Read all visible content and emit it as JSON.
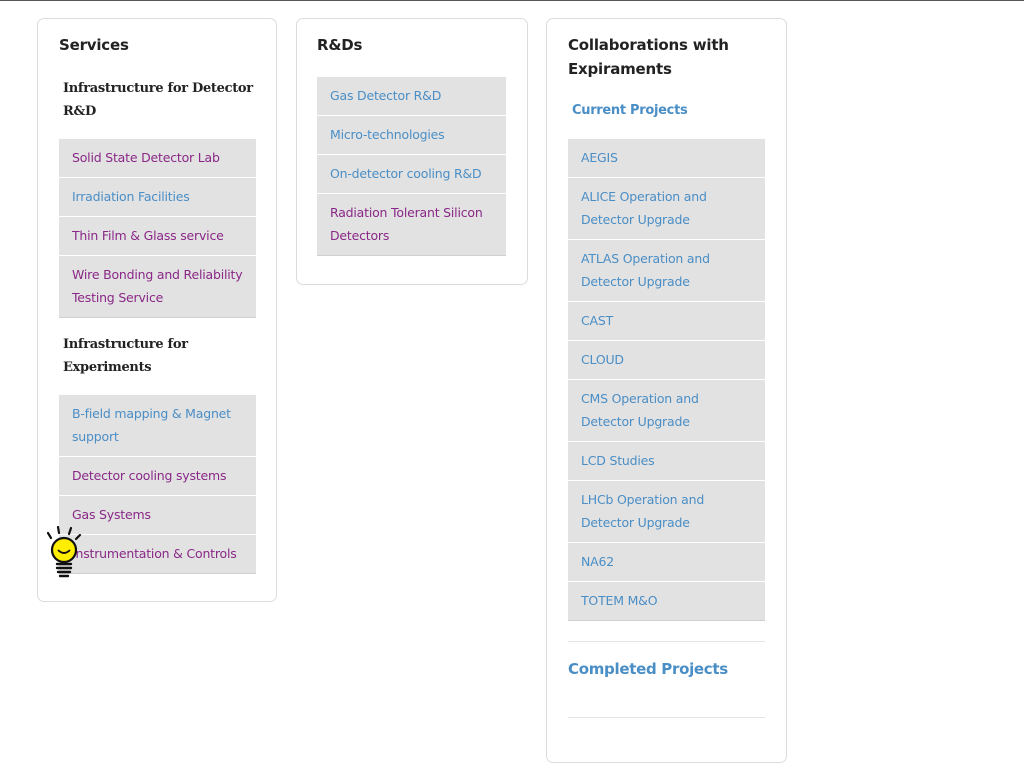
{
  "services": {
    "title": "Services",
    "detector_rnd_heading": "Infrastructure for Detector R&D",
    "detector_rnd_items": [
      {
        "label": "Solid State Detector Lab",
        "color": "#8a2887"
      },
      {
        "label": "Irradiation Facilities",
        "color": "#4a8ec6"
      },
      {
        "label": "Thin Film & Glass service",
        "color": "#8a2887"
      },
      {
        "label": "Wire Bonding and Reliability Testing Service",
        "color": "#8a2887"
      }
    ],
    "experiments_heading": "Infrastructure for Experiments",
    "experiments_items": [
      {
        "label": "B-field mapping & Magnet support",
        "color": "#4a8ec6"
      },
      {
        "label": "Detector cooling systems",
        "color": "#8a2887"
      },
      {
        "label": "Gas Systems",
        "color": "#8a2887"
      },
      {
        "label": "Instrumentation & Controls",
        "color": "#8a2887"
      }
    ]
  },
  "rnd": {
    "title": "R&Ds",
    "items": [
      {
        "label": "Gas Detector R&D",
        "color": "#4a8ec6"
      },
      {
        "label": "Micro-technologies",
        "color": "#4a8ec6"
      },
      {
        "label": "On-detector cooling R&D",
        "color": "#4a8ec6"
      },
      {
        "label": "Radiation Tolerant Silicon Detectors",
        "color": "#8a2887"
      }
    ]
  },
  "collaborations": {
    "title": "Collaborations with Expiraments",
    "current_heading": "Current Projects",
    "current_items": [
      {
        "label": "AEGIS",
        "color": "#4a8ec6"
      },
      {
        "label": "ALICE Operation and Detector Upgrade",
        "color": "#4a8ec6"
      },
      {
        "label": "ATLAS Operation and Detector Upgrade",
        "color": "#4a8ec6"
      },
      {
        "label": "CAST",
        "color": "#4a8ec6"
      },
      {
        "label": "CLOUD",
        "color": "#4a8ec6"
      },
      {
        "label": "CMS Operation and Detector Upgrade",
        "color": "#4a8ec6"
      },
      {
        "label": "LCD Studies",
        "color": "#4a8ec6"
      },
      {
        "label": "LHCb Operation and Detector Upgrade",
        "color": "#4a8ec6"
      },
      {
        "label": "NA62",
        "color": "#4a8ec6"
      },
      {
        "label": "TOTEM M&O",
        "color": "#4a8ec6"
      }
    ],
    "completed_heading": "Completed Projects"
  },
  "colors": {
    "link_purple": "#8a2887",
    "link_blue": "#4a8ec6",
    "menu_background": "#e2e2e2",
    "cursor_yellow": "#ffee00"
  },
  "cursor": {
    "icon": "lightbulb-cursor-icon"
  }
}
